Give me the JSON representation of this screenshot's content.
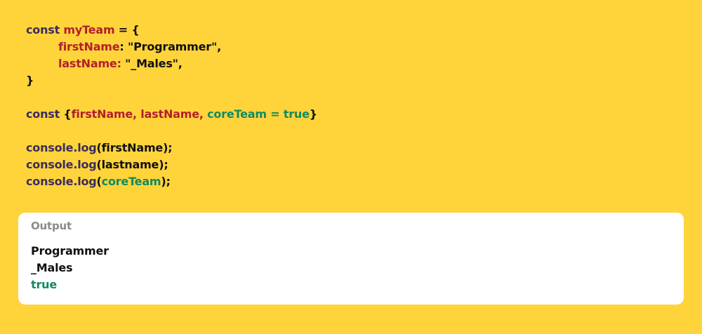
{
  "colors": {
    "background": "#FFD43B",
    "keyword": "#3B2C5C",
    "variable": "#B3202A",
    "green": "#138A5E",
    "text": "#111111",
    "output_title": "#8A8A8A",
    "panel": "#FFFFFF"
  },
  "code": {
    "line1": {
      "kw": "const",
      "var": "myTeam",
      "rest": " = {"
    },
    "line2": {
      "prop": "firstName",
      "rest": ": \"Programmer\","
    },
    "line3": {
      "prop": "lastName:",
      "rest": " \"_Males\","
    },
    "line4": {
      "text": "}"
    },
    "line6": {
      "kw": "const",
      "open": "{",
      "vars": "firstName, lastName, ",
      "default": "coreTeam = true",
      "close": "}"
    },
    "line8": {
      "fn": "console.log",
      "args": "(firstName);"
    },
    "line9": {
      "fn": "console.log",
      "args": "(lastname);"
    },
    "line10": {
      "fn": "console.log",
      "open": "(",
      "arg": "coreTeam",
      "close": ");"
    }
  },
  "output": {
    "title": "Output",
    "lines": [
      "Programmer",
      "_Males",
      "true"
    ]
  }
}
